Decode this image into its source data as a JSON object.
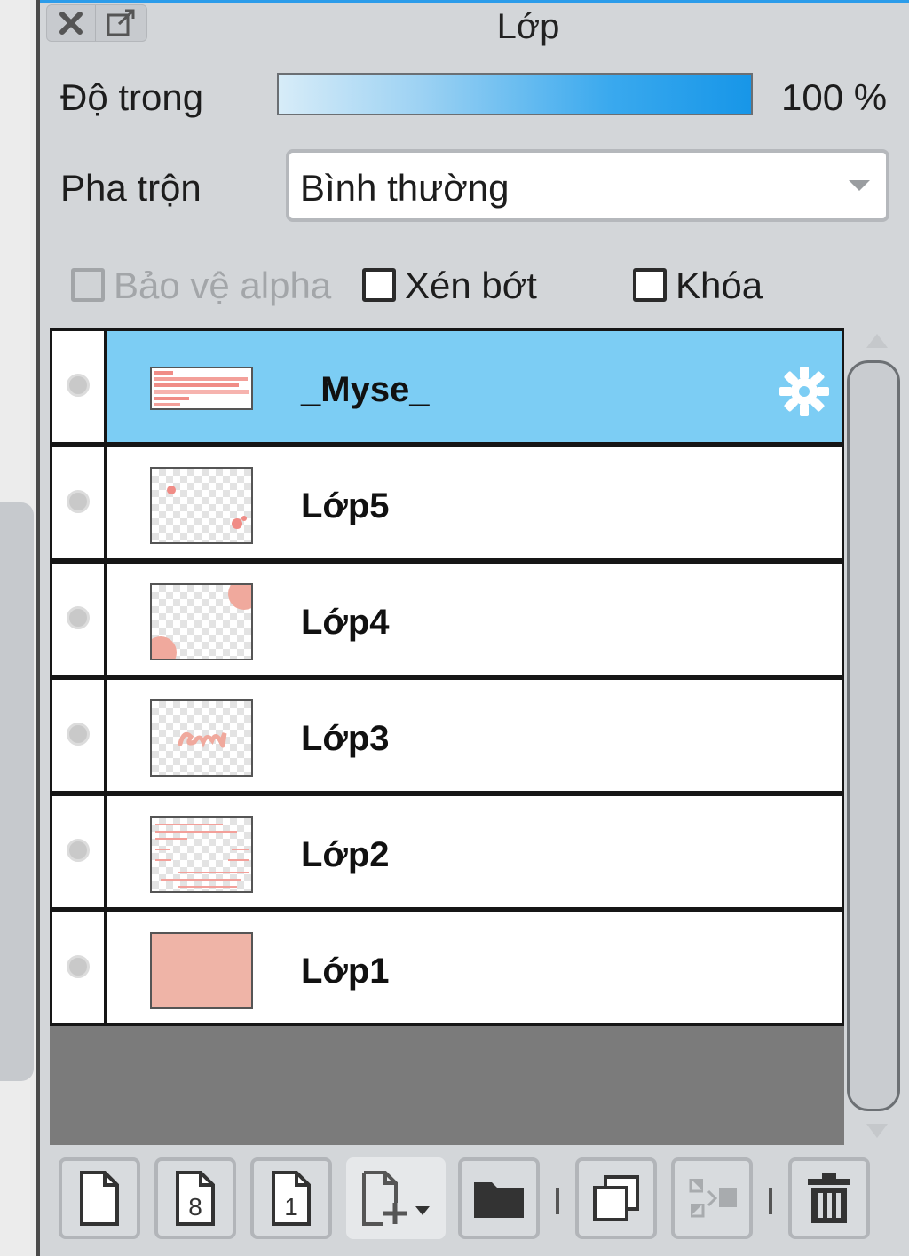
{
  "panel": {
    "title": "Lớp"
  },
  "opacity": {
    "label": "Độ trong",
    "value": "100 %",
    "fraction": 1.0
  },
  "blend": {
    "label": "Pha trộn",
    "selected": "Bình thường"
  },
  "options": {
    "protect_alpha": {
      "label": "Bảo vệ alpha",
      "checked": false,
      "disabled": true
    },
    "clip": {
      "label": "Xén bớt",
      "checked": false
    },
    "lock": {
      "label": "Khóa",
      "checked": false
    }
  },
  "layers": [
    {
      "name": "_Myse_",
      "selected": true
    },
    {
      "name": "Lớp5",
      "selected": false
    },
    {
      "name": "Lớp4",
      "selected": false
    },
    {
      "name": "Lớp3",
      "selected": false
    },
    {
      "name": "Lớp2",
      "selected": false
    },
    {
      "name": "Lớp1",
      "selected": false
    }
  ],
  "toolbar": {
    "buttons": [
      "new-layer-icon",
      "new-8bit-layer-icon",
      "new-1bit-layer-icon",
      "add-layer-dropdown-icon",
      "new-folder-icon",
      "duplicate-layer-icon",
      "merge-down-icon",
      "delete-layer-icon"
    ]
  },
  "colors": {
    "selected_row": "#7ccdf4",
    "opacity_bar_end": "#1796e8",
    "panel_bg": "#d3d6d9",
    "layer1_fill": "#efb4a7",
    "pink_content": "#f08c86"
  }
}
